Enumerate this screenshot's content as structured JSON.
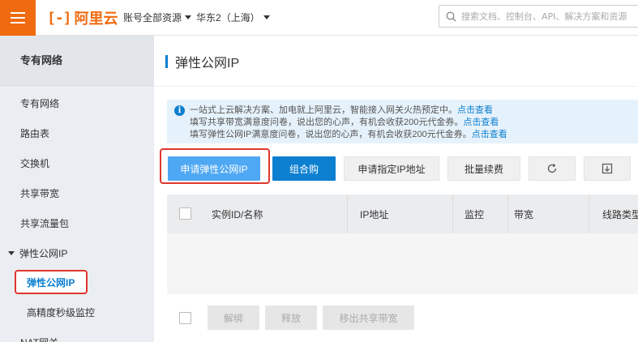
{
  "topbar": {
    "brand": "阿里云",
    "account": "账号全部资源",
    "region": "华东2（上海）",
    "search_placeholder": "搜索文档、控制台、API、解决方案和资源"
  },
  "sidebar": {
    "title": "专有网络",
    "items": [
      "专有网络",
      "路由表",
      "交换机",
      "共享带宽",
      "共享流量包"
    ],
    "group": "弹性公网IP",
    "active": "弹性公网IP",
    "sub": "高精度秒级监控",
    "last": "NAT网关"
  },
  "main": {
    "title": "弹性公网IP",
    "notice": {
      "line1": "一站式上云解决方案、加电就上阿里云，智能接入网关火热预定中。",
      "line2": "填写共享带宽满意度问卷，说出您的心声，有机会收获200元代金券。",
      "line3": "填写弹性公网IP满意度问卷，说出您的心声，有机会收获200元代金券。",
      "link": "点击查看"
    },
    "buttons": {
      "apply": "申请弹性公网IP",
      "combo": "组合购",
      "apply_ip": "申请指定IP地址",
      "renew": "批量续费"
    },
    "table": {
      "columns": [
        "实例ID/名称",
        "IP地址",
        "监控",
        "带宽",
        "线路类型"
      ]
    },
    "bottom_buttons": {
      "unbind": "解绑",
      "release": "释放",
      "remove_bw": "移出共享带宽"
    }
  },
  "colors": {
    "brand": "#f06a0f",
    "primary": "#0c7fd0",
    "highlight": "#e0372e"
  }
}
